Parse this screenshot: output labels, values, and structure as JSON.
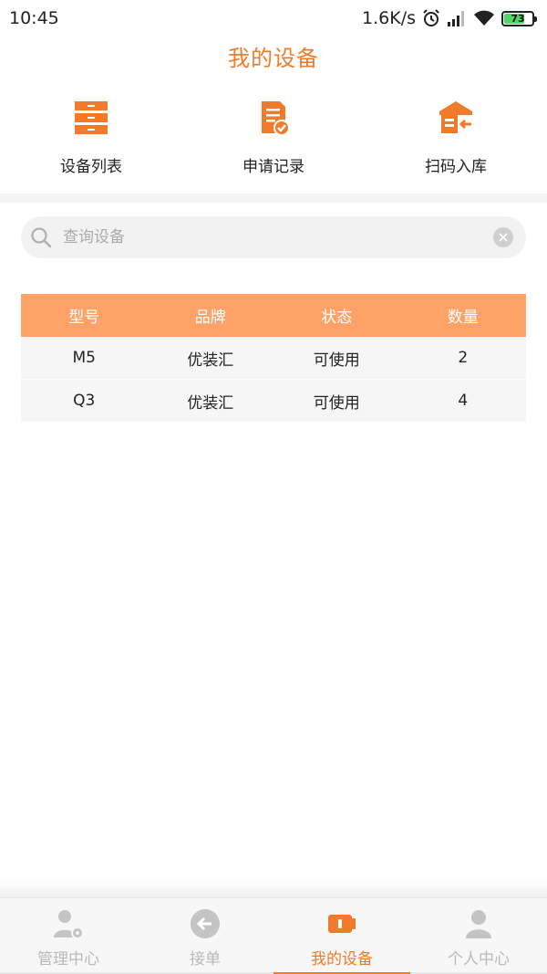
{
  "status_bar": {
    "time": "10:45",
    "network_speed": "1.6K/s",
    "battery": "73",
    "icons": [
      "alarm-icon",
      "signal-icon",
      "wifi-icon",
      "battery-icon"
    ]
  },
  "header": {
    "title": "我的设备"
  },
  "actions": [
    {
      "label": "设备列表",
      "icon": "device-list-icon"
    },
    {
      "label": "申请记录",
      "icon": "application-record-icon"
    },
    {
      "label": "扫码入库",
      "icon": "scan-warehouse-icon"
    }
  ],
  "search": {
    "placeholder": "查询设备",
    "value": ""
  },
  "table": {
    "headers": [
      "型号",
      "品牌",
      "状态",
      "数量"
    ],
    "rows": [
      [
        "M5",
        "优装汇",
        "可使用",
        "2"
      ],
      [
        "Q3",
        "优装汇",
        "可使用",
        "4"
      ]
    ]
  },
  "bottom_nav": [
    {
      "label": "管理中心",
      "icon": "user-settings-icon",
      "active": false
    },
    {
      "label": "接单",
      "icon": "back-arrow-icon",
      "active": false
    },
    {
      "label": "我的设备",
      "icon": "device-icon",
      "active": true
    },
    {
      "label": "个人中心",
      "icon": "person-icon",
      "active": false
    }
  ],
  "colors": {
    "accent": "#f07b2b",
    "table_header": "#ffa268",
    "inactive": "#b9b9b9"
  }
}
